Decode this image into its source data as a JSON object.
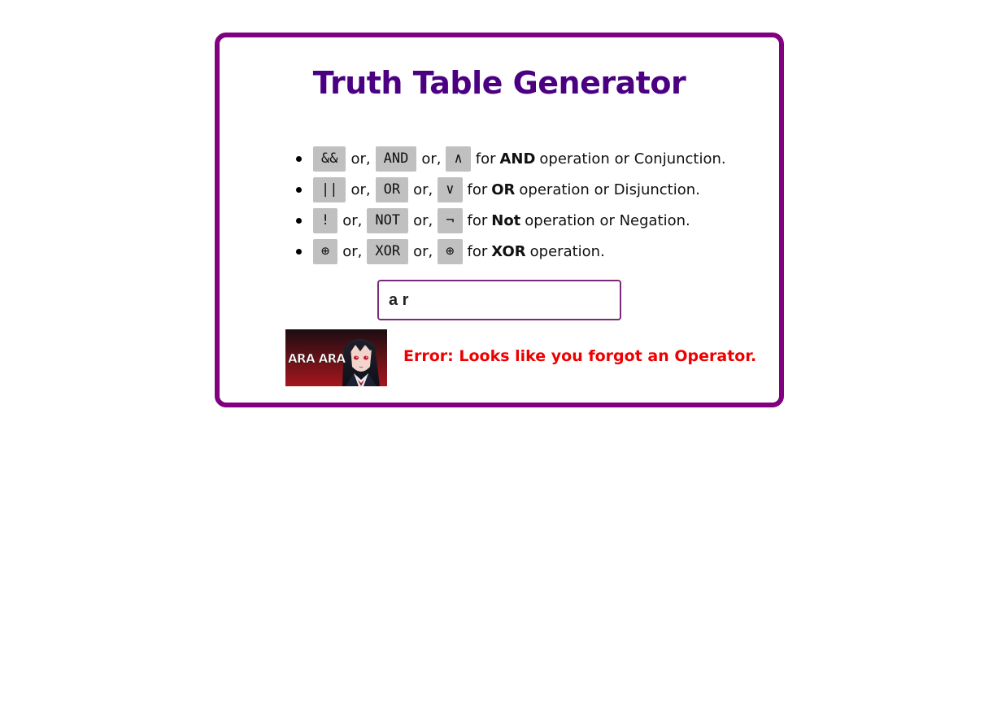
{
  "title": "Truth Table Generator",
  "operators": [
    {
      "symbols": [
        "&&",
        "AND",
        "∧"
      ],
      "name": "AND",
      "desc": "operation or Conjunction."
    },
    {
      "symbols": [
        "||",
        "OR",
        "∨"
      ],
      "name": "OR",
      "desc": "operation or Disjunction."
    },
    {
      "symbols": [
        "!",
        "NOT",
        "¬"
      ],
      "name": "Not",
      "desc": "operation or Negation."
    },
    {
      "symbols": [
        "⊕",
        "XOR",
        "⊕"
      ],
      "name": "XOR",
      "desc": "operation."
    }
  ],
  "words": {
    "or": "or,",
    "for": "for"
  },
  "input": {
    "value": "a r",
    "placeholder": ""
  },
  "meme": {
    "caption": "ARA ARA"
  },
  "error": "Error: Looks like you forgot an Operator.",
  "colors": {
    "border": "#800080",
    "title": "#4b0082",
    "error": "#ee0000",
    "chip": "#c0c0c0"
  }
}
